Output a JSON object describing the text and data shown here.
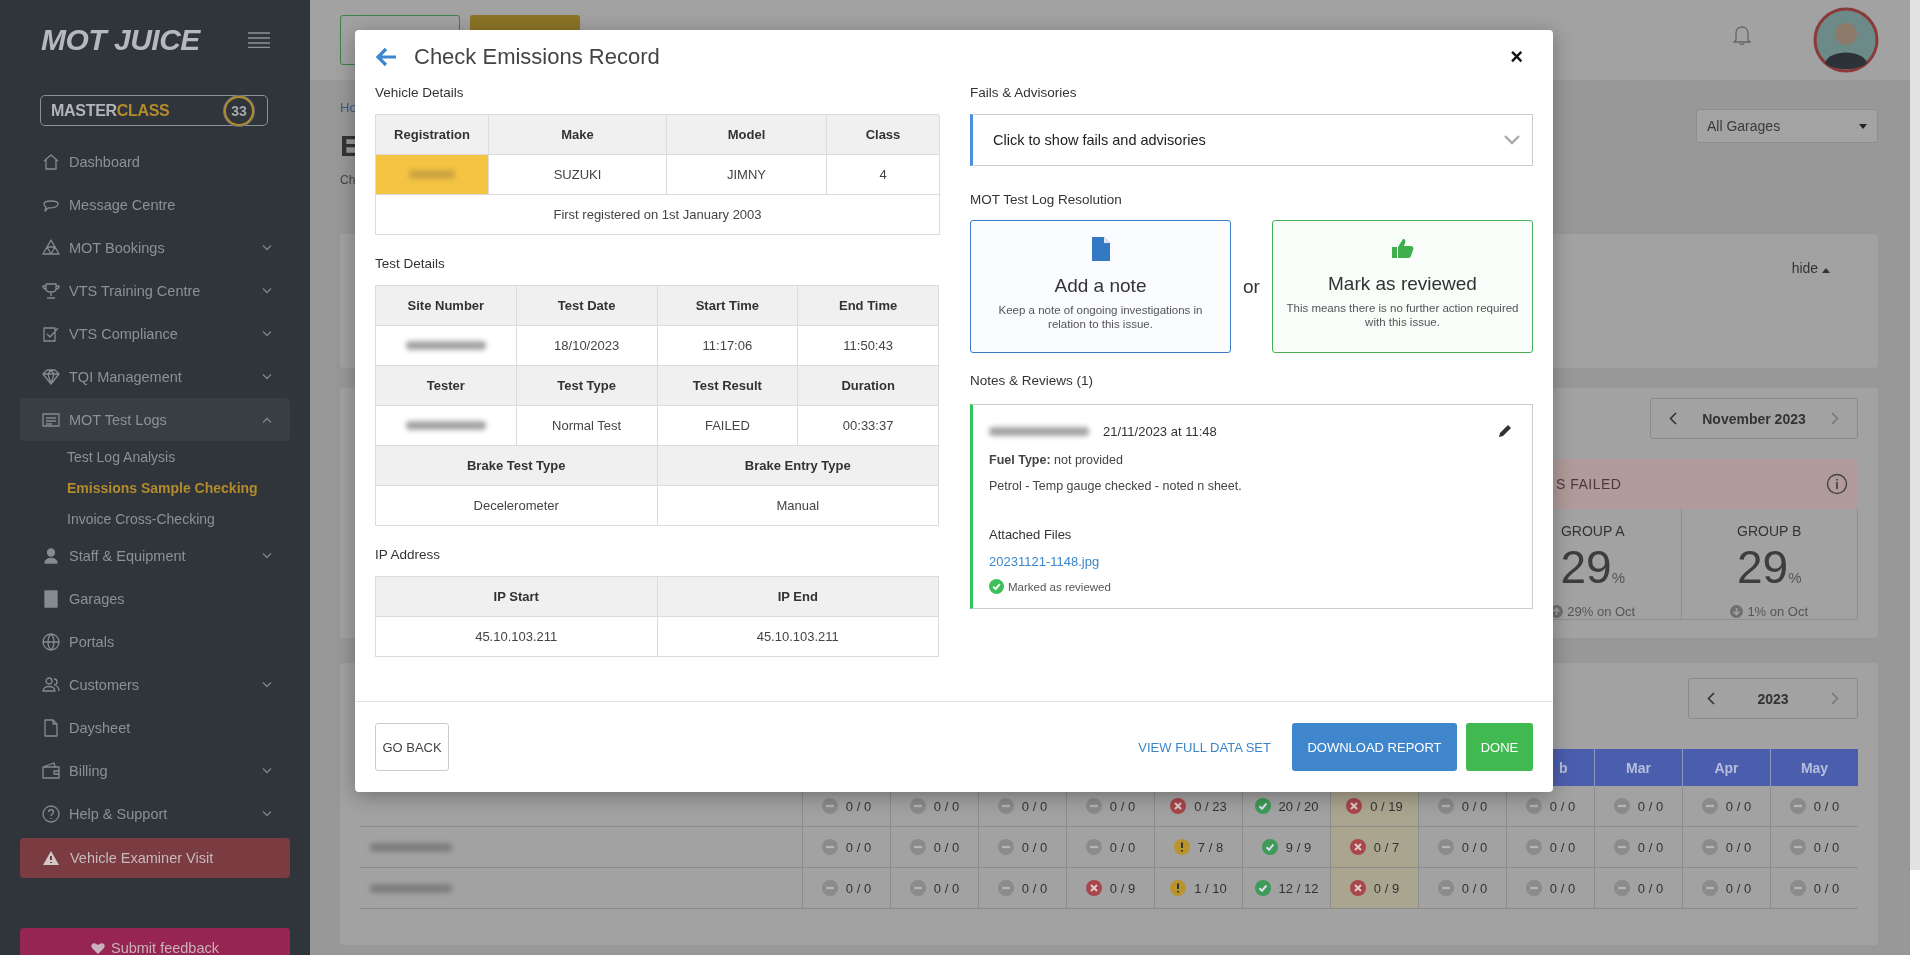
{
  "sidebar": {
    "logo": "MOT JUICE",
    "badge": {
      "part_a": "MASTER",
      "part_b": "CLASS",
      "count": "33"
    },
    "items": [
      {
        "label": "Dashboard",
        "has_submenu": false,
        "expanded": false
      },
      {
        "label": "Message Centre",
        "has_submenu": false,
        "expanded": false
      },
      {
        "label": "MOT Bookings",
        "has_submenu": true,
        "expanded": false
      },
      {
        "label": "VTS Training Centre",
        "has_submenu": true,
        "expanded": false
      },
      {
        "label": "VTS Compliance",
        "has_submenu": true,
        "expanded": false
      },
      {
        "label": "TQI Management",
        "has_submenu": true,
        "expanded": false
      },
      {
        "label": "MOT Test Logs",
        "has_submenu": true,
        "expanded": true,
        "children": [
          {
            "label": "Test Log Analysis",
            "selected": false
          },
          {
            "label": "Emissions Sample Checking",
            "selected": true
          },
          {
            "label": "Invoice Cross-Checking",
            "selected": false
          }
        ]
      },
      {
        "label": "Staff & Equipment",
        "has_submenu": true,
        "expanded": false
      },
      {
        "label": "Garages",
        "has_submenu": false,
        "expanded": false
      },
      {
        "label": "Portals",
        "has_submenu": false,
        "expanded": false
      },
      {
        "label": "Customers",
        "has_submenu": true,
        "expanded": false
      },
      {
        "label": "Daysheet",
        "has_submenu": false,
        "expanded": false
      },
      {
        "label": "Billing",
        "has_submenu": true,
        "expanded": false
      },
      {
        "label": "Help & Support",
        "has_submenu": true,
        "expanded": false
      }
    ],
    "alert_button": "Vehicle Examiner Visit",
    "feedback_button": "Submit feedback"
  },
  "page": {
    "breadcrumb": "Ho",
    "title": "E",
    "subtitle": "Ch",
    "garage_select": "All Garages",
    "summary_card": {
      "toggle": "hide"
    },
    "month_card": {
      "period": "November 2023",
      "banner": "S FAILED",
      "groups": [
        {
          "name": "GROUP A",
          "value": "29",
          "unit": "%",
          "change": "29% on Oct",
          "kind": "up"
        },
        {
          "name": "GROUP B",
          "value": "29",
          "unit": "%",
          "change": "1% on Oct",
          "kind": "down"
        }
      ]
    },
    "year_card": {
      "period": "2023",
      "months": [
        "b",
        "Mar",
        "Apr",
        "May"
      ],
      "rows": [
        {
          "cells": [
            {
              "text": "0 / 0",
              "kind": "none"
            },
            {
              "text": "0 / 0",
              "kind": "none"
            },
            {
              "text": "0 / 0",
              "kind": "none"
            },
            {
              "text": "0 / 0",
              "kind": "none"
            },
            {
              "text": "0 / 23",
              "kind": "fail"
            },
            {
              "text": "20 / 20",
              "kind": "pass"
            },
            {
              "text": "0 / 19",
              "kind": "fail",
              "highlight": true
            },
            {
              "text": "0 / 0",
              "kind": "none"
            },
            {
              "text": "0 / 0",
              "kind": "none"
            },
            {
              "text": "0 / 0",
              "kind": "none"
            },
            {
              "text": "0 / 0",
              "kind": "none"
            },
            {
              "text": "0 / 0",
              "kind": "none"
            }
          ]
        },
        {
          "redacted": true,
          "cells": [
            {
              "text": "0 / 0",
              "kind": "none"
            },
            {
              "text": "0 / 0",
              "kind": "none"
            },
            {
              "text": "0 / 0",
              "kind": "none"
            },
            {
              "text": "0 / 0",
              "kind": "none"
            },
            {
              "text": "7 / 8",
              "kind": "warn"
            },
            {
              "text": "9 / 9",
              "kind": "pass"
            },
            {
              "text": "0 / 7",
              "kind": "fail",
              "highlight": true
            },
            {
              "text": "0 / 0",
              "kind": "none"
            },
            {
              "text": "0 / 0",
              "kind": "none"
            },
            {
              "text": "0 / 0",
              "kind": "none"
            },
            {
              "text": "0 / 0",
              "kind": "none"
            },
            {
              "text": "0 / 0",
              "kind": "none"
            }
          ]
        },
        {
          "redacted": true,
          "cells": [
            {
              "text": "0 / 0",
              "kind": "none"
            },
            {
              "text": "0 / 0",
              "kind": "none"
            },
            {
              "text": "0 / 0",
              "kind": "none"
            },
            {
              "text": "0 / 9",
              "kind": "fail"
            },
            {
              "text": "1 / 10",
              "kind": "warn"
            },
            {
              "text": "12 / 12",
              "kind": "pass"
            },
            {
              "text": "0 / 9",
              "kind": "fail",
              "highlight": true
            },
            {
              "text": "0 / 0",
              "kind": "none"
            },
            {
              "text": "0 / 0",
              "kind": "none"
            },
            {
              "text": "0 / 0",
              "kind": "none"
            },
            {
              "text": "0 / 0",
              "kind": "none"
            },
            {
              "text": "0 / 0",
              "kind": "none"
            }
          ]
        }
      ]
    }
  },
  "modal": {
    "title": "Check Emissions Record",
    "close": "×",
    "vehicle": {
      "heading": "Vehicle Details",
      "columns": [
        "Registration",
        "Make",
        "Model",
        "Class"
      ],
      "registration_redacted": true,
      "values": [
        "SUZUKI",
        "JIMNY",
        "4"
      ],
      "note": "First registered on 1st January 2003"
    },
    "test": {
      "heading": "Test Details",
      "rows": [
        {
          "headers": [
            "Site Number",
            "Test Date",
            "Start Time",
            "End Time"
          ],
          "values": [
            {
              "redacted": true
            },
            {
              "text": "18/10/2023"
            },
            {
              "text": "11:17:06"
            },
            {
              "text": "11:50:43"
            }
          ]
        },
        {
          "headers": [
            "Tester",
            "Test Type",
            "Test Result",
            "Duration"
          ],
          "values": [
            {
              "redacted": true
            },
            {
              "text": "Normal Test"
            },
            {
              "text": "FAILED"
            },
            {
              "text": "00:33:37"
            }
          ]
        },
        {
          "headers": [
            "Brake Test Type",
            "Brake Entry Type"
          ],
          "values": [
            {
              "text": "Decelerometer"
            },
            {
              "text": "Manual"
            }
          ]
        }
      ]
    },
    "ip": {
      "heading": "IP Address",
      "headers": [
        "IP Start",
        "IP End"
      ],
      "values": [
        "45.10.103.211",
        "45.10.103.211"
      ]
    },
    "fails": {
      "heading": "Fails & Advisories",
      "dropdown": "Click to show fails and advisories",
      "expanded": false
    },
    "resolution": {
      "heading": "MOT Test Log Resolution",
      "separator": "or",
      "options": [
        {
          "kind": "note",
          "title": "Add a note",
          "text": "Keep a note of ongoing investigations in relation to this issue."
        },
        {
          "kind": "review",
          "title": "Mark as reviewed",
          "text": "This means there is no further action required with this issue."
        }
      ]
    },
    "notes": {
      "heading": "Notes & Reviews (1)",
      "items": [
        {
          "author_redacted": true,
          "time": "21/11/2023 at 11:48",
          "fuel": "**Fuel Type:** not provided",
          "text": "Petrol - Temp gauge checked - noted n sheet.",
          "files_label": "Attached Files",
          "files": [
            "20231121-1148.jpg"
          ],
          "reviewed": true,
          "review_text": "Marked as reviewed"
        }
      ]
    },
    "footer": {
      "back": "GO BACK",
      "link": "VIEW FULL DATA SET",
      "download": "DOWNLOAD REPORT",
      "done": "DONE"
    }
  }
}
